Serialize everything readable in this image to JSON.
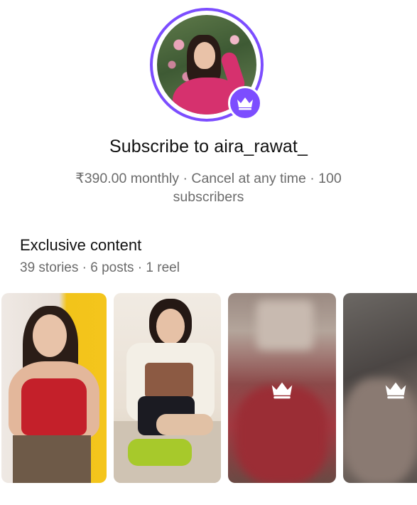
{
  "profile": {
    "avatar_icon": "profile-photo",
    "badge_icon": "crown-icon",
    "accent_color": "#7c4dff"
  },
  "header": {
    "title": "Subscribe to aira_rawat_",
    "subtitle": "₹390.00 monthly · Cancel at any time · 100 subscribers"
  },
  "exclusive": {
    "title": "Exclusive content",
    "meta": "39 stories · 6 posts · 1 reel",
    "thumbnails": [
      {
        "locked": false
      },
      {
        "locked": false
      },
      {
        "locked": true,
        "icon": "crown-icon"
      },
      {
        "locked": true,
        "icon": "crown-icon"
      }
    ]
  }
}
